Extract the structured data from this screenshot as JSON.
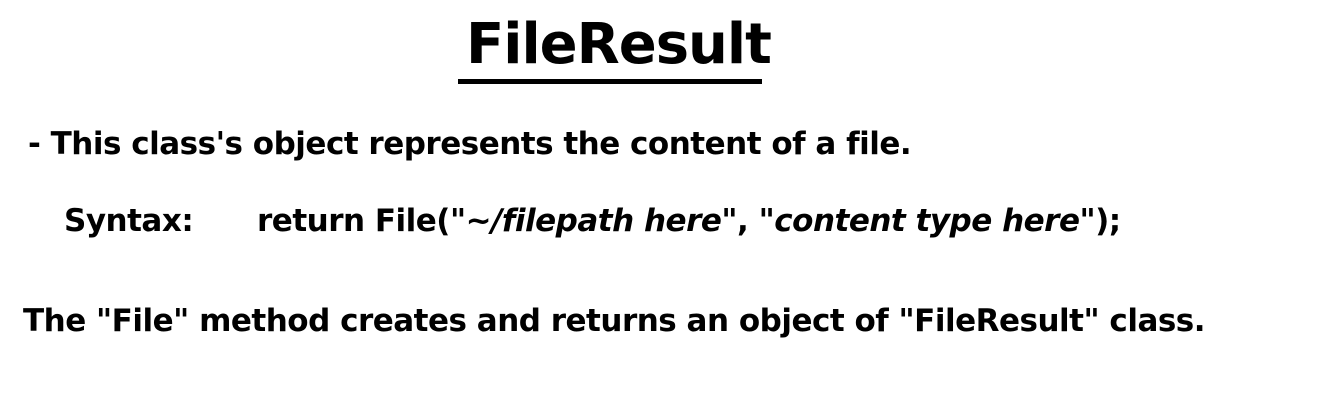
{
  "document": {
    "title": "FileResult",
    "description": "- This class's object represents the content of a file.",
    "syntax": {
      "label": "Syntax:",
      "code_prefix": "return File(\"",
      "path_placeholder": "~/filepath here",
      "code_middle": "\", \"",
      "content_type_placeholder": "content type here",
      "code_suffix": "\");"
    },
    "note": "The \"File\" method creates and returns an object of \"FileResult\" class."
  }
}
